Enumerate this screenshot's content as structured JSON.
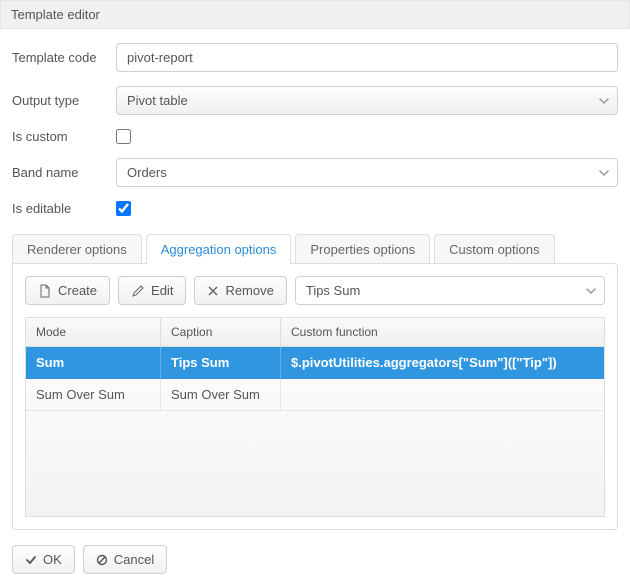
{
  "window_title": "Template editor",
  "form": {
    "template_code_label": "Template code",
    "template_code_value": "pivot-report",
    "output_type_label": "Output type",
    "output_type_value": "Pivot table",
    "is_custom_label": "Is custom",
    "is_custom_checked": false,
    "band_name_label": "Band name",
    "band_name_value": "Orders",
    "is_editable_label": "Is editable",
    "is_editable_checked": true
  },
  "tabs": {
    "renderer": "Renderer options",
    "aggregation": "Aggregation options",
    "properties": "Properties options",
    "custom": "Custom options"
  },
  "toolbar": {
    "create_label": "Create",
    "edit_label": "Edit",
    "remove_label": "Remove",
    "select_value": "Tips Sum"
  },
  "grid": {
    "headers": {
      "mode": "Mode",
      "caption": "Caption",
      "custom": "Custom function"
    },
    "rows": [
      {
        "mode": "Sum",
        "caption": "Tips Sum",
        "custom": "$.pivotUtilities.aggregators[\"Sum\"]([\"Tip\"])",
        "selected": true
      },
      {
        "mode": "Sum Over Sum",
        "caption": "Sum Over Sum",
        "custom": "",
        "selected": false
      }
    ]
  },
  "footer": {
    "ok_label": "OK",
    "cancel_label": "Cancel"
  }
}
